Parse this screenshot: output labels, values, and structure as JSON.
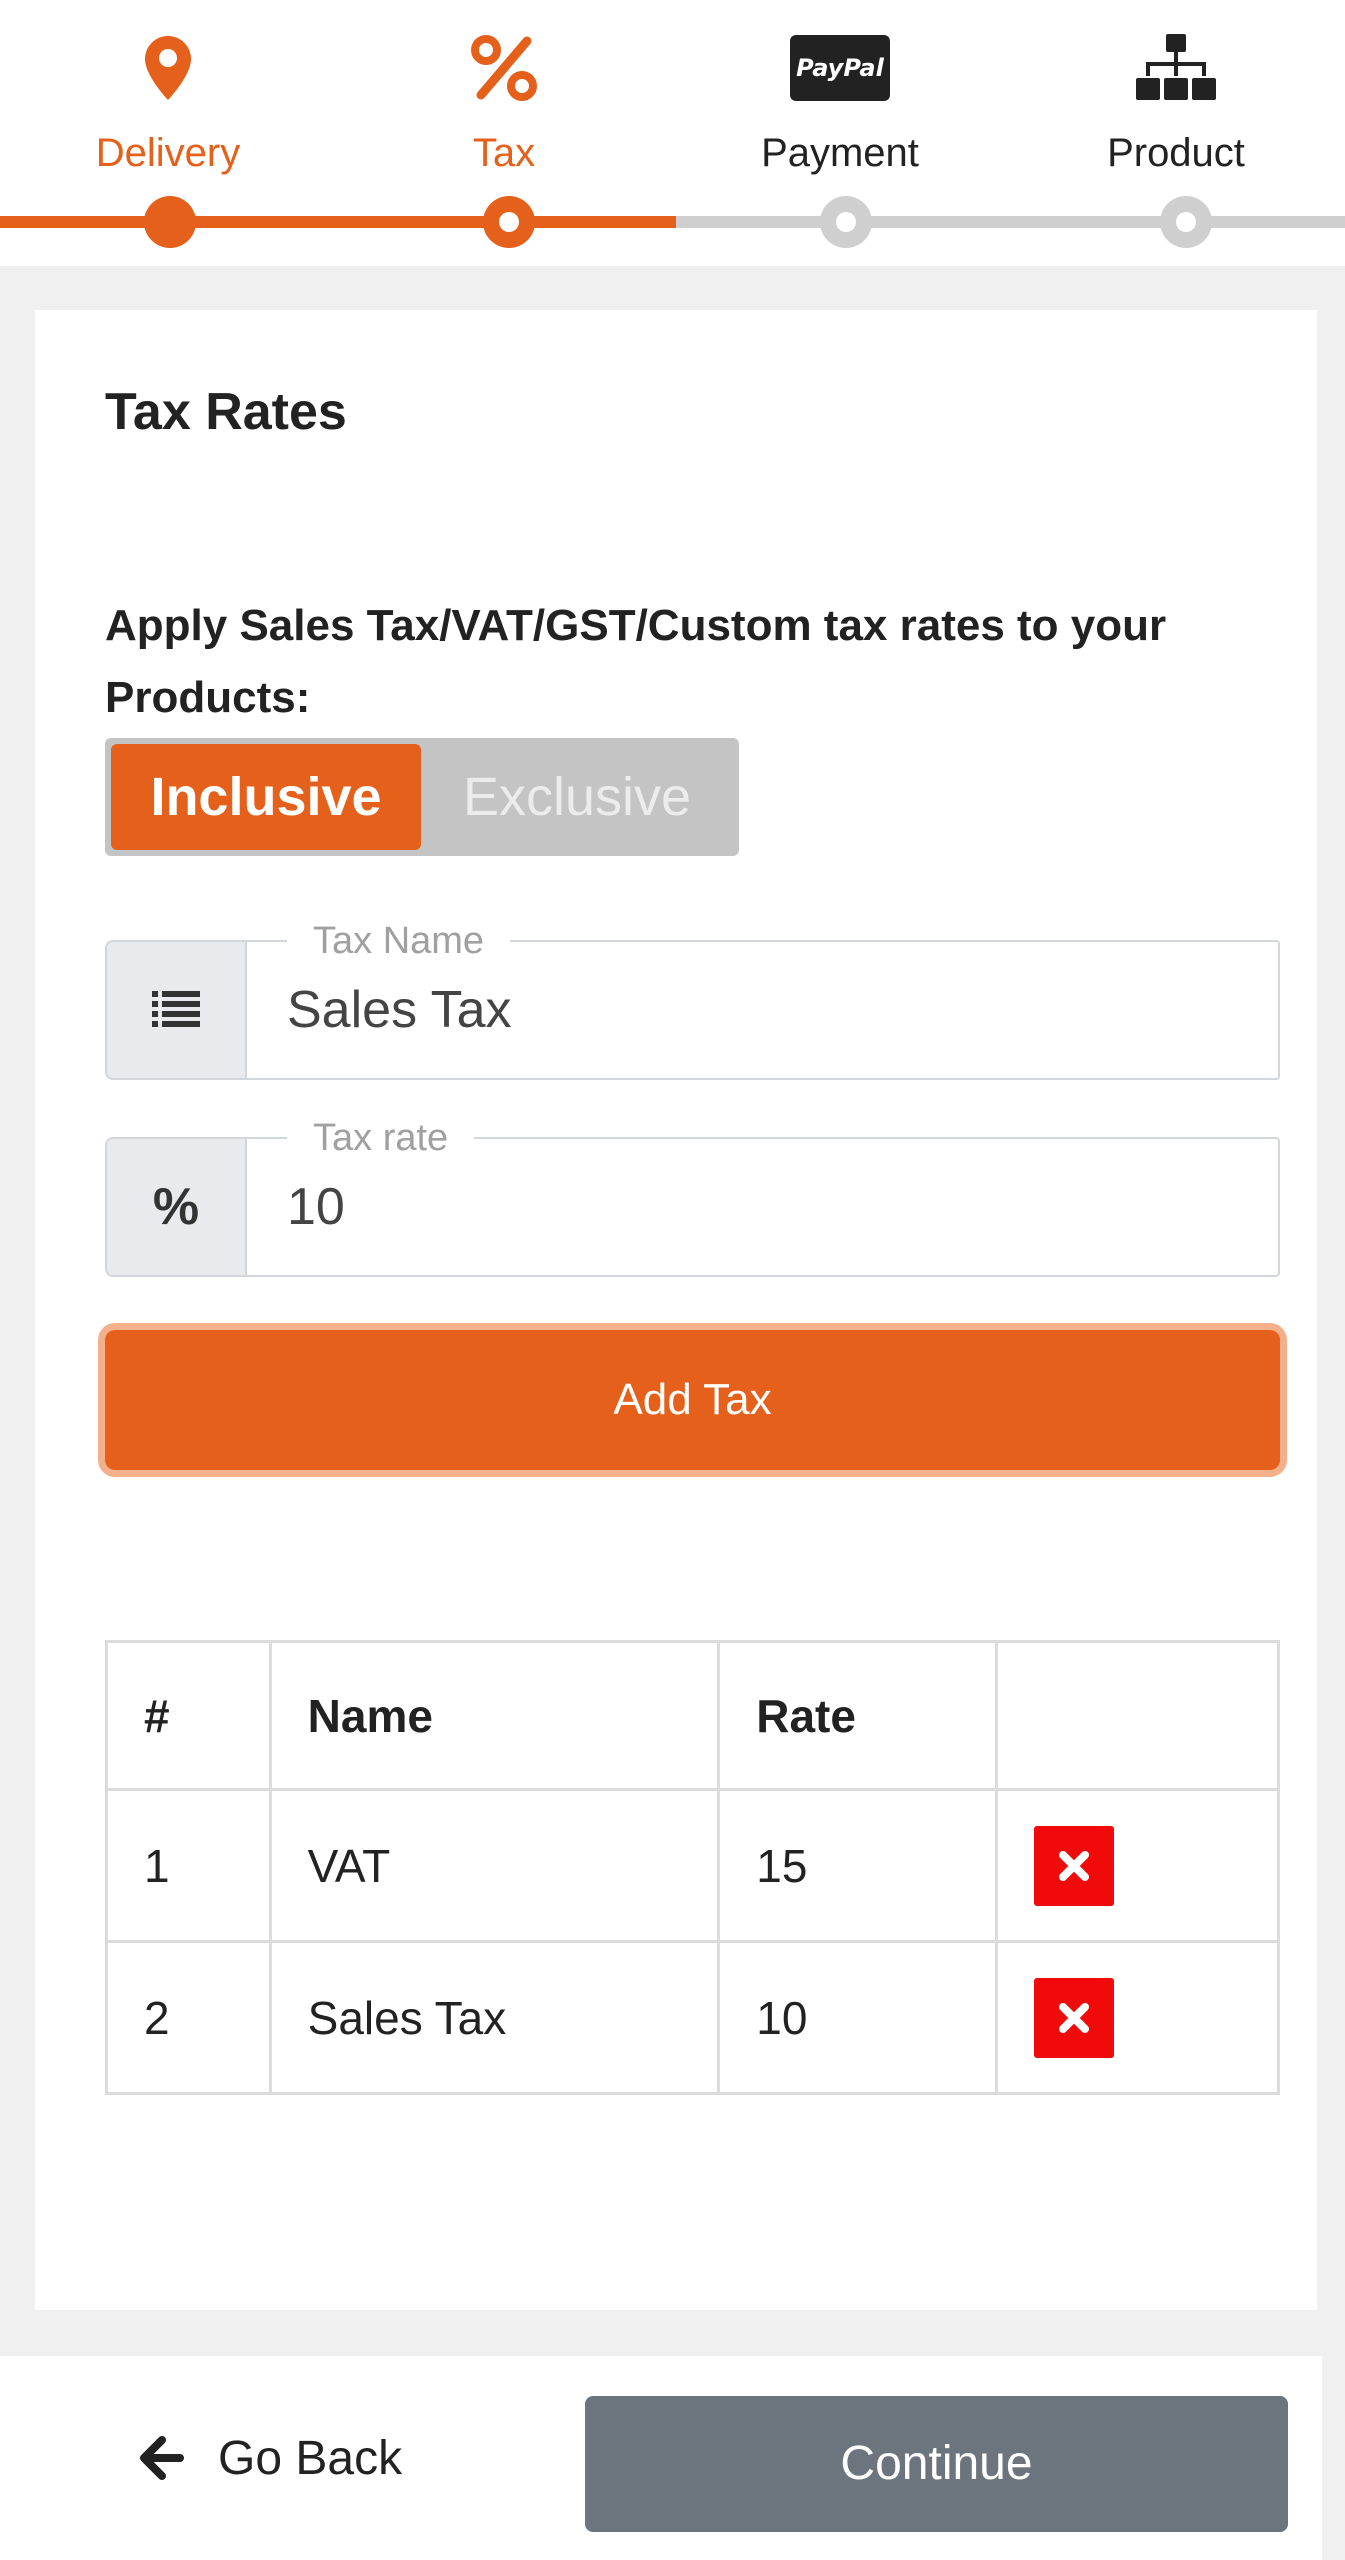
{
  "stepper": {
    "steps": [
      {
        "label": "Delivery",
        "icon": "map-pin-icon",
        "state": "done"
      },
      {
        "label": "Tax",
        "icon": "percent-icon",
        "state": "current"
      },
      {
        "label": "Payment",
        "icon": "paypal-icon",
        "state": "todo"
      },
      {
        "label": "Product",
        "icon": "sitemap-icon",
        "state": "todo"
      }
    ],
    "paypal_logo_text": "PayPal",
    "accent_color": "#e5601a",
    "inactive_color": "#cfcfcf"
  },
  "tax_card": {
    "title": "Tax Rates",
    "instructions": "Apply Sales Tax/VAT/GST/Custom tax rates to your Products:",
    "toggle": {
      "selected": "Inclusive",
      "options": [
        "Inclusive",
        "Exclusive"
      ]
    },
    "tax_name": {
      "legend": "Tax Name",
      "value": "Sales Tax",
      "icon": "list-icon"
    },
    "tax_rate": {
      "legend": "Tax rate",
      "value": "10",
      "addon": "%"
    },
    "add_button": "Add Tax",
    "table": {
      "headers": [
        "#",
        "Name",
        "Rate",
        ""
      ],
      "rows": [
        {
          "num": "1",
          "name": "VAT",
          "rate": "15"
        },
        {
          "num": "2",
          "name": "Sales Tax",
          "rate": "10"
        }
      ],
      "delete_color": "#f00a0a"
    }
  },
  "footer": {
    "back_label": "Go Back",
    "continue_label": "Continue"
  }
}
